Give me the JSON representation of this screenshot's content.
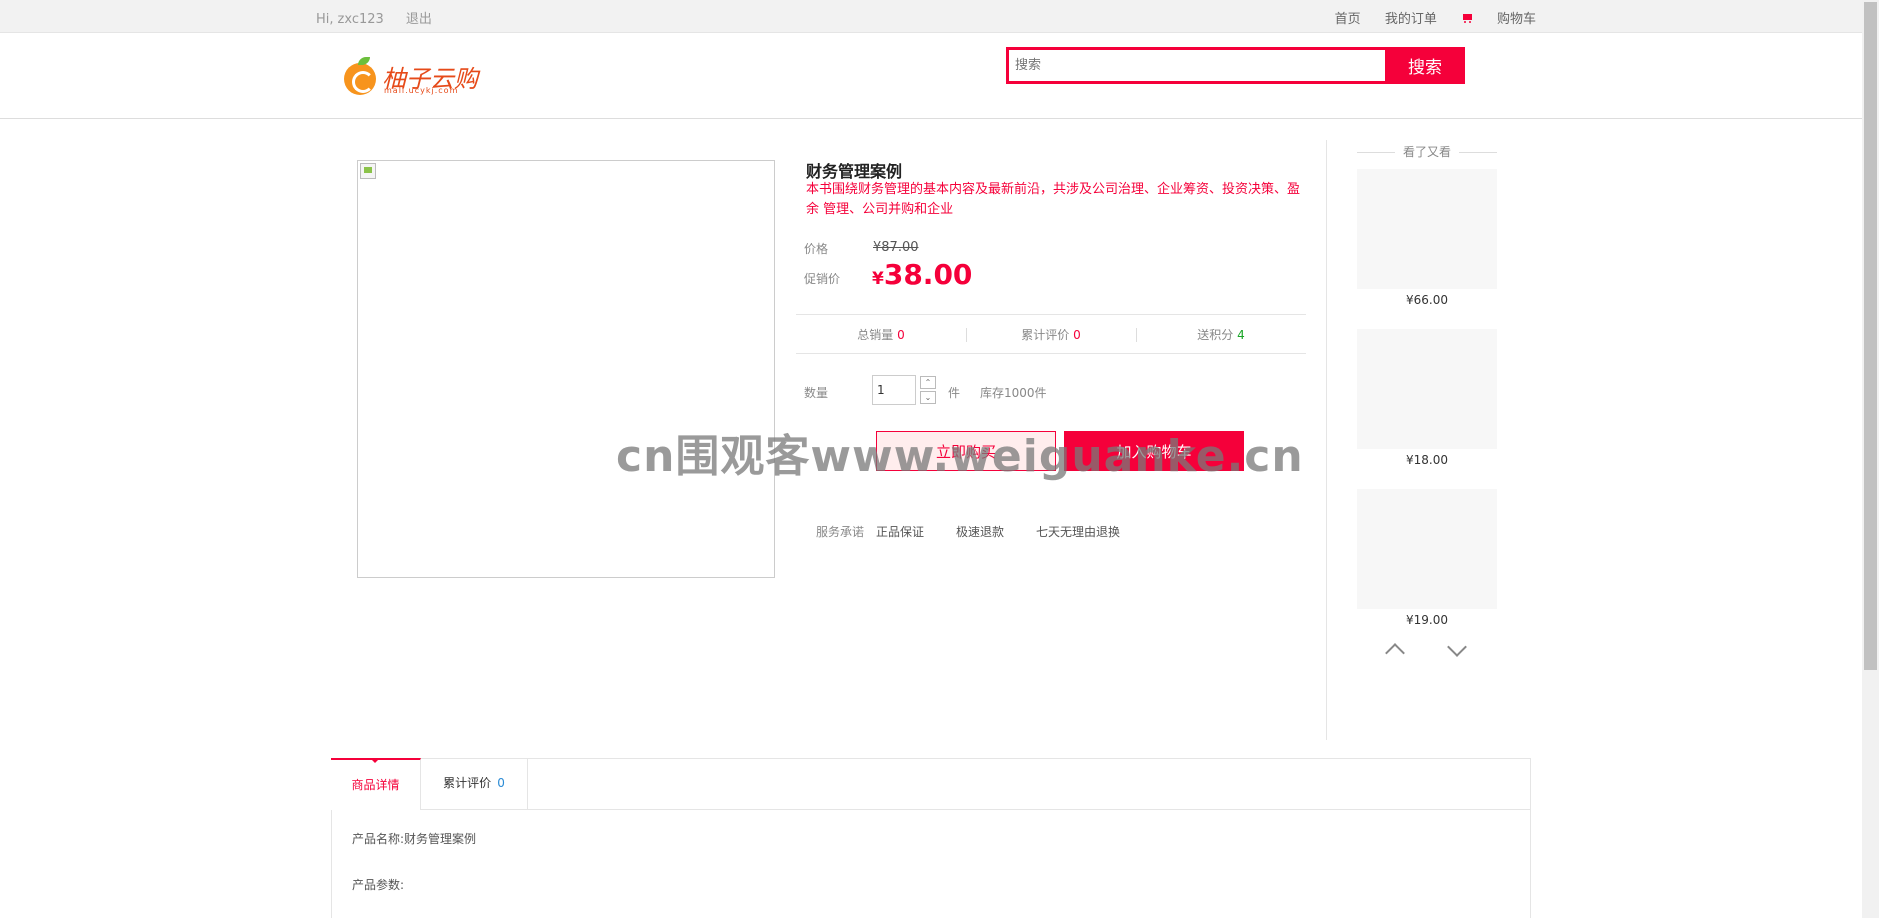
{
  "topbar": {
    "greeting": "Hi,",
    "username": "zxc123",
    "logout": "退出",
    "links": [
      "首页",
      "我的订单",
      "购物车"
    ]
  },
  "header": {
    "logo_text": "柚子云购",
    "logo_url": "mall.ucykj.com",
    "search_placeholder": "搜索",
    "search_button": "搜索"
  },
  "product": {
    "title": "财务管理案例",
    "description": "本书围绕财务管理的基本内容及最新前沿，共涉及公司治理、企业筹资、投资决策、盈余 管理、公司并购和企业",
    "price_label": "价格",
    "price": "¥87.00",
    "promo_label": "促销价",
    "promo_currency": "¥",
    "promo_price": "38.00",
    "stats": [
      {
        "label": "总销量",
        "value": "0",
        "color": "red"
      },
      {
        "label": "累计评价",
        "value": "0",
        "color": "red"
      },
      {
        "label": "送积分",
        "value": "4",
        "color": "green"
      }
    ],
    "quantity_label": "数量",
    "quantity": "1",
    "unit": "件",
    "stock": "库存1000件",
    "buy_now": "立即购买",
    "add_to_cart": "加入购物车",
    "service_label": "服务承诺",
    "services": [
      "正品保证",
      "极速退款",
      "七天无理由退换"
    ]
  },
  "side": {
    "heading": "看了又看",
    "items": [
      {
        "price": "¥66.00"
      },
      {
        "price": "¥18.00"
      },
      {
        "price": "¥19.00"
      }
    ]
  },
  "tabs": [
    {
      "label": "商品详情",
      "active": true
    },
    {
      "label": "累计评价",
      "count": "0"
    }
  ],
  "detail": {
    "name_label": "产品名称:",
    "name_value": "财务管理案例",
    "params_label": "产品参数:"
  },
  "watermark": "cn围观客www.weiguanke.cn",
  "colors": {
    "accent": "#f5003a",
    "green": "#19a526",
    "link_blue": "#2a8bd5"
  }
}
